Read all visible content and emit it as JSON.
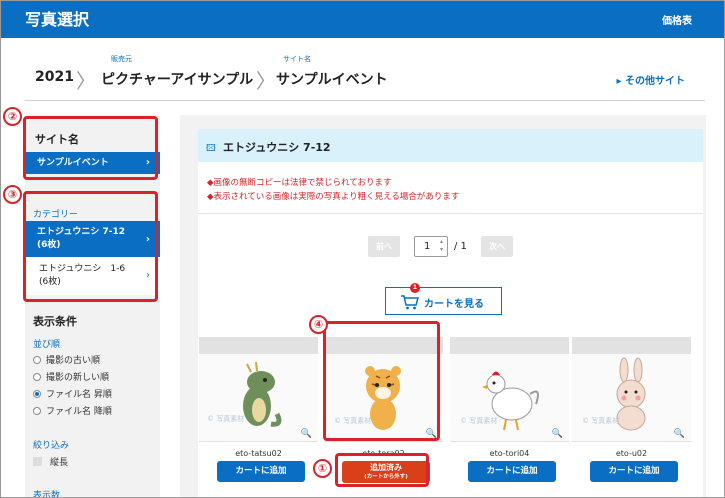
{
  "header": {
    "title": "写真選択",
    "price_list": "価格表"
  },
  "breadcrumb": {
    "year": "2021",
    "seller_caption": "販売元",
    "seller": "ピクチャーアイサンプル",
    "site_caption": "サイト名",
    "site": "サンプルイベント",
    "other_sites": "▸ その他サイト"
  },
  "sidebar": {
    "site_heading": "サイト名",
    "site_selected": "サンプルイベント",
    "category_caption": "カテゴリー",
    "categories": [
      {
        "line1": "エトジュウニシ 7-12",
        "line2": "(6枚)"
      },
      {
        "line1": "エトジュウニシ　1-6",
        "line2": "(6枚)"
      }
    ],
    "display_heading": "表示条件",
    "sort_caption": "並び順",
    "sort_options": [
      "撮影の古い順",
      "撮影の新しい順",
      "ファイル名 昇順",
      "ファイル名 降順"
    ],
    "sort_selected_index": 2,
    "filter_caption": "絞り込み",
    "filter_option": "縦長",
    "count_caption": "表示数"
  },
  "main": {
    "category_title": "エトジュウニシ 7-12",
    "notice1": "◆画像の無断コピーは法律で禁じられております",
    "notice2": "◆表示されている画像は実際の写真より粗く見える場合があります",
    "prev": "前へ",
    "next": "次へ",
    "page": "1",
    "total": "/ 1",
    "view_cart": "カートを見る",
    "cart_count": "1",
    "photos": [
      {
        "name": "eto-tatsu02",
        "button": "カートに追加"
      },
      {
        "name": "eto-tora02",
        "button_line1": "追加済み",
        "button_line2": "(カートから外す)"
      },
      {
        "name": "eto-tori04",
        "button": "カートに追加"
      },
      {
        "name": "eto-u02",
        "button": "カートに追加"
      }
    ]
  },
  "callouts": [
    "①",
    "②",
    "③",
    "④"
  ],
  "colors": {
    "brand": "#0a6fc2",
    "accent": "#d9222a",
    "added": "#d9401a",
    "info_bg": "#d9f1fa"
  }
}
